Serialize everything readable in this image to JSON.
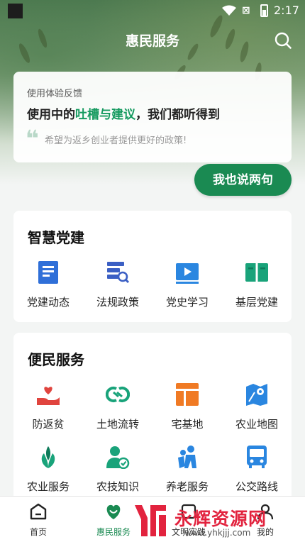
{
  "status_bar": {
    "time": "2:17"
  },
  "header": {
    "title": "惠民服务"
  },
  "feedback": {
    "label": "使用体验反馈",
    "headline_prefix": "使用中的",
    "headline_accent": "吐槽与建议",
    "headline_suffix": "，我们都听得到",
    "example": "希望为返乡创业者提供更好的政策!",
    "button_label": "我也说两句"
  },
  "party_section": {
    "title": "智慧党建",
    "items": [
      {
        "label": "党建动态",
        "icon": "document-icon"
      },
      {
        "label": "法规政策",
        "icon": "law-search-icon"
      },
      {
        "label": "党史学习",
        "icon": "video-play-icon"
      },
      {
        "label": "基层党建",
        "icon": "book-icon"
      }
    ]
  },
  "service_section": {
    "title": "便民服务",
    "items": [
      {
        "label": "防返贫",
        "icon": "heart-hand-icon"
      },
      {
        "label": "土地流转",
        "icon": "transfer-icon"
      },
      {
        "label": "宅基地",
        "icon": "layout-icon"
      },
      {
        "label": "农业地图",
        "icon": "map-icon"
      },
      {
        "label": "农业服务",
        "icon": "sprout-icon"
      },
      {
        "label": "农技知识",
        "icon": "expert-icon"
      },
      {
        "label": "养老服务",
        "icon": "elderly-icon"
      },
      {
        "label": "公交路线",
        "icon": "bus-icon"
      }
    ]
  },
  "tabbar": {
    "tabs": [
      {
        "label": "首页",
        "icon": "home-icon"
      },
      {
        "label": "惠民服务",
        "icon": "smile-heart-icon",
        "active": true
      },
      {
        "label": "文明实践",
        "icon": "practice-icon"
      },
      {
        "label": "我的",
        "icon": "user-icon"
      }
    ]
  },
  "watermark": {
    "text": "永辉资源网",
    "url": "www.yhkjjj.com"
  },
  "colors": {
    "accent": "#1a8a52",
    "accent_text": "#159a5f",
    "service_red": "#e0443e",
    "party_blue": "#2f6fd8"
  }
}
